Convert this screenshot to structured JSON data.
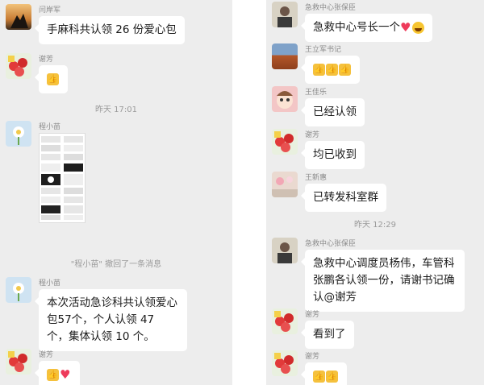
{
  "left": {
    "m1": {
      "sender": "闫岸军",
      "text": "手麻科共认领 26 份爱心包"
    },
    "m2": {
      "sender": "谢芳",
      "emoji": [
        "thumbs-up"
      ]
    },
    "time1": "昨天 17:01",
    "m3": {
      "sender": "程小苗"
    },
    "system": "\"程小苗\" 撤回了一条消息",
    "m4": {
      "sender": "程小苗",
      "text": "本次活动急诊科共认领爱心包57个，个人认领 47 个，集体认领 10 个。"
    },
    "m5": {
      "sender": "谢芳",
      "emoji": [
        "thumbs-up",
        "heart"
      ]
    }
  },
  "right": {
    "m1": {
      "sender": "急救中心张保臣",
      "text": "急救中心号长一个"
    },
    "m2": {
      "sender": "王立军书记",
      "emoji": [
        "thumbs-up",
        "thumbs-up",
        "thumbs-up"
      ]
    },
    "m3": {
      "sender": "王佳乐",
      "text": "已经认领"
    },
    "m4": {
      "sender": "谢芳",
      "text": "均已收到"
    },
    "m5": {
      "sender": "王新惠",
      "text": "已转发科室群"
    },
    "time1": "昨天 12:29",
    "m6": {
      "sender": "急救中心张保臣",
      "text": "急救中心调度员杨伟，车管科张鹏各认领一份，请谢书记确认@谢芳"
    },
    "m7": {
      "sender": "谢芳",
      "text": "看到了"
    },
    "m8": {
      "sender": "谢芳",
      "emoji": [
        "thumbs-up",
        "thumbs-up"
      ]
    }
  }
}
